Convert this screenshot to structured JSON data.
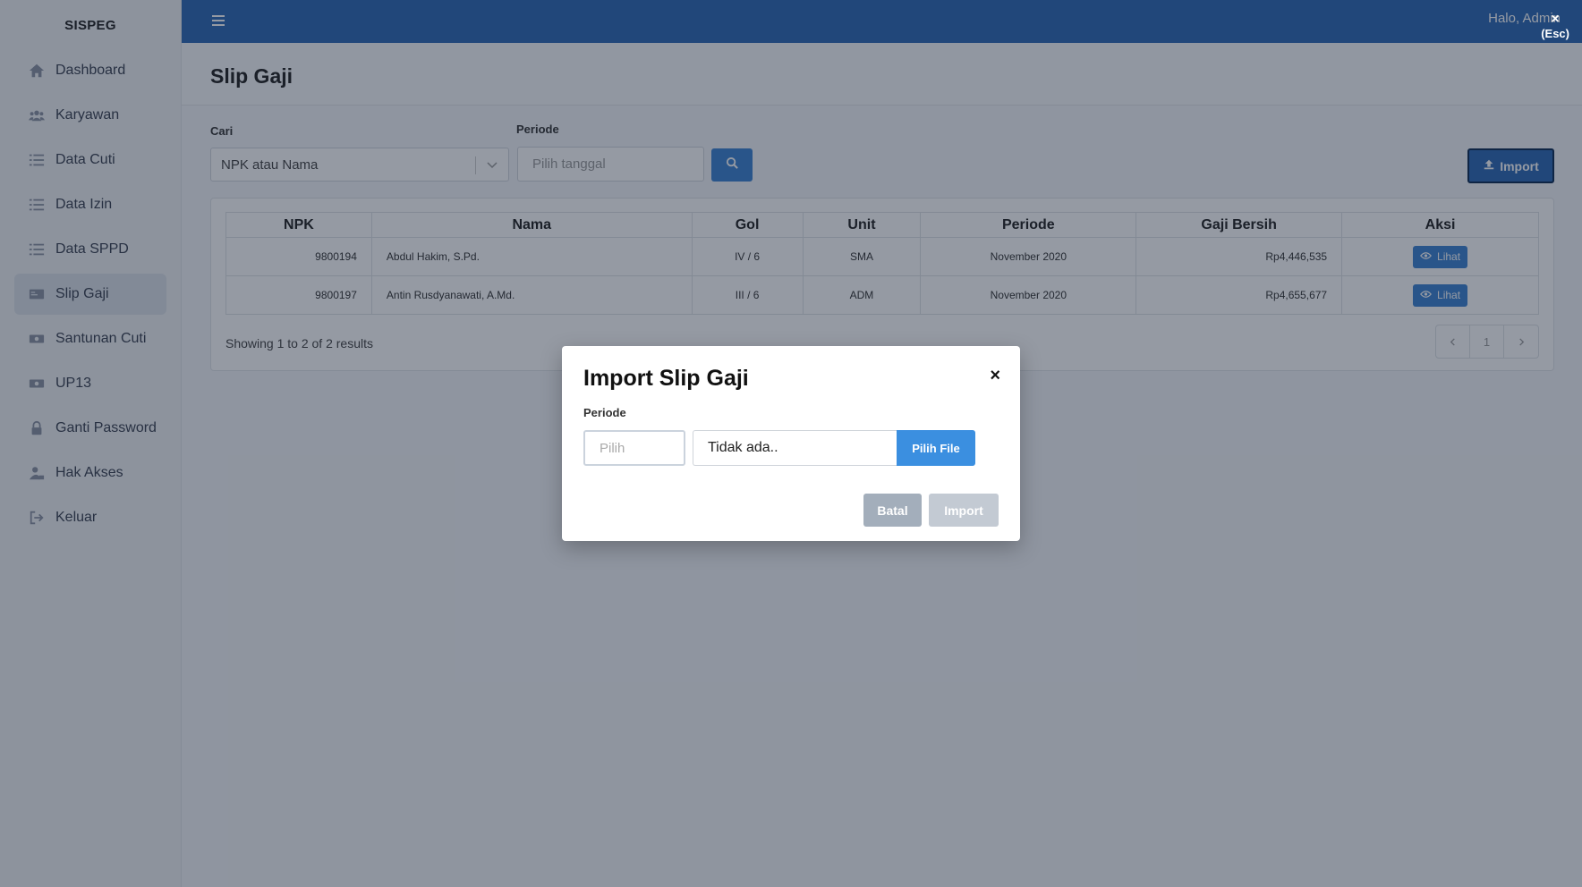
{
  "brand": "SISPEG",
  "sidebar": {
    "items": [
      {
        "label": "Dashboard",
        "icon": "home-icon"
      },
      {
        "label": "Karyawan",
        "icon": "users-icon"
      },
      {
        "label": "Data Cuti",
        "icon": "list-icon"
      },
      {
        "label": "Data Izin",
        "icon": "list-icon"
      },
      {
        "label": "Data SPPD",
        "icon": "list-icon"
      },
      {
        "label": "Slip Gaji",
        "icon": "id-card-icon",
        "active": true
      },
      {
        "label": "Santunan Cuti",
        "icon": "money-icon"
      },
      {
        "label": "UP13",
        "icon": "money-icon"
      },
      {
        "label": "Ganti Password",
        "icon": "lock-icon"
      },
      {
        "label": "Hak Akses",
        "icon": "user-lock-icon"
      },
      {
        "label": "Keluar",
        "icon": "sign-out-icon"
      }
    ]
  },
  "topbar": {
    "greeting": "Halo, Admin"
  },
  "page": {
    "title": "Slip Gaji"
  },
  "filters": {
    "cari_label": "Cari",
    "cari_placeholder": "NPK atau Nama",
    "periode_label": "Periode",
    "periode_placeholder": "Pilih tanggal",
    "import_label": "Import"
  },
  "table": {
    "headers": [
      "NPK",
      "Nama",
      "Gol",
      "Unit",
      "Periode",
      "Gaji Bersih",
      "Aksi"
    ],
    "rows": [
      {
        "npk": "9800194",
        "nama": "Abdul Hakim, S.Pd.",
        "gol": "IV / 6",
        "unit": "SMA",
        "periode": "November 2020",
        "gaji": "Rp4,446,535",
        "aksi": "Lihat"
      },
      {
        "npk": "9800197",
        "nama": "Antin Rusdyanawati, A.Md.",
        "gol": "III / 6",
        "unit": "ADM",
        "periode": "November 2020",
        "gaji": "Rp4,655,677",
        "aksi": "Lihat"
      }
    ],
    "summary": "Showing 1 to 2 of 2 results",
    "current_page": "1"
  },
  "overlay": {
    "close_x": "×",
    "close_hint": "(Esc)"
  },
  "modal": {
    "title": "Import Slip Gaji",
    "close": "×",
    "periode_label": "Periode",
    "periode_placeholder": "Pilih",
    "file_name": "Tidak ada..",
    "file_button": "Pilih File",
    "cancel": "Batal",
    "submit": "Import"
  }
}
